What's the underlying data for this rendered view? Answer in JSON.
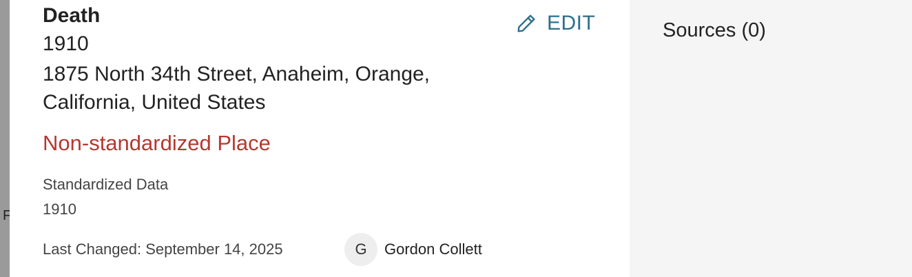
{
  "event": {
    "title": "Death",
    "date": "1910",
    "place": "1875 North 34th Street, Anaheim, Orange, California, United States",
    "place_warning": "Non-standardized Place",
    "standardized_label": "Standardized Data",
    "standardized_value": "1910",
    "last_changed": "Last Changed: September 14, 2025",
    "contributor": {
      "initial": "G",
      "name": "Gordon Collett"
    },
    "edit_label": "EDIT",
    "edit_icon": "pencil-icon"
  },
  "sidebar": {
    "sources_label": "Sources (0)"
  },
  "backdrop": {
    "glyph": "F"
  },
  "colors": {
    "warning": "#b23a30",
    "link": "#2e6f8a",
    "text": "#222222",
    "muted": "#444444",
    "sidebar_bg": "#f5f5f5"
  }
}
